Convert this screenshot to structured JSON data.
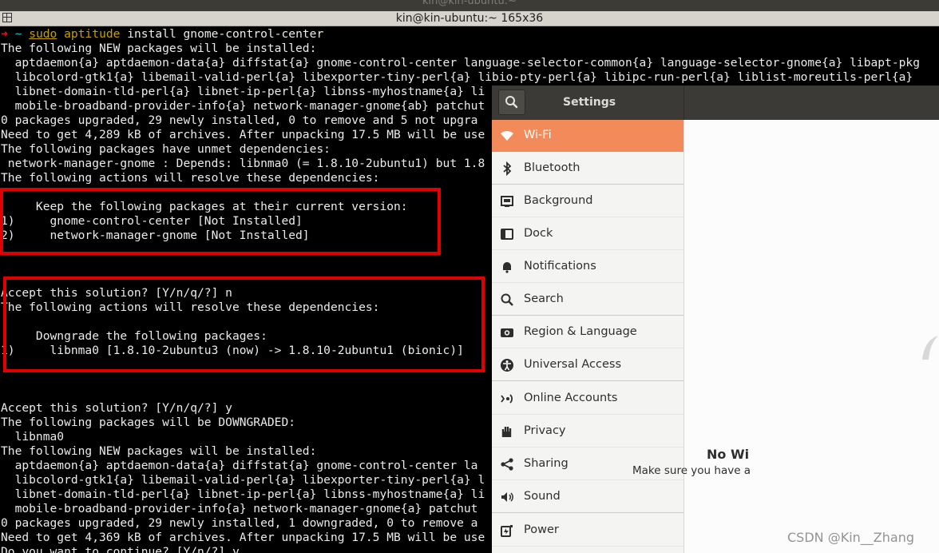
{
  "outer_window": {
    "title": "kin@kin-ubuntu:~"
  },
  "terminal": {
    "title": "kin@kin-ubuntu:~ 165x36",
    "prompt_arrow": "➜",
    "prompt_dir": "~",
    "command_sudo": "sudo",
    "command_aptitude": "aptitude",
    "command_rest": " install gnome-control-center",
    "lines": [
      "The following NEW packages will be installed:",
      "  aptdaemon{a} aptdaemon-data{a} diffstat{a} gnome-control-center language-selector-common{a} language-selector-gnome{a} libapt-pkg",
      "  libcolord-gtk1{a} libemail-valid-perl{a} libexporter-tiny-perl{a} libio-pty-perl{a} libipc-run-perl{a} liblist-moreutils-perl{a}",
      "  libnet-domain-tld-perl{a} libnet-ip-perl{a} libnss-myhostname{a} li",
      "  mobile-broadband-provider-info{a} network-manager-gnome{ab} patchut",
      "0 packages upgraded, 29 newly installed, 0 to remove and 5 not upgra",
      "Need to get 4,289 kB of archives. After unpacking 17.5 MB will be use",
      "The following packages have unmet dependencies:",
      " network-manager-gnome : Depends: libnma0 (= 1.8.10-2ubuntu1) but 1.8",
      "The following actions will resolve these dependencies:",
      "",
      "     Keep the following packages at their current version:",
      "1)     gnome-control-center [Not Installed]",
      "2)     network-manager-gnome [Not Installed]",
      "",
      "",
      "",
      "Accept this solution? [Y/n/q/?] n",
      "The following actions will resolve these dependencies:",
      "",
      "     Downgrade the following packages:",
      "1)     libnma0 [1.8.10-2ubuntu3 (now) -> 1.8.10-2ubuntu1 (bionic)]",
      "",
      "",
      "",
      "Accept this solution? [Y/n/q/?] y",
      "The following packages will be DOWNGRADED:",
      "  libnma0",
      "The following NEW packages will be installed:",
      "  aptdaemon{a} aptdaemon-data{a} diffstat{a} gnome-control-center la",
      "  libcolord-gtk1{a} libemail-valid-perl{a} libexporter-tiny-perl{a} l",
      "  libnet-domain-tld-perl{a} libnet-ip-perl{a} libnss-myhostname{a} li",
      "  mobile-broadband-provider-info{a} network-manager-gnome{a} patchut",
      "0 packages upgraded, 29 newly installed, 1 downgraded, 0 to remove a",
      "Need to get 4,369 kB of archives. After unpacking 17.5 MB will be use",
      "Do you want to continue? [Y/n/?] y"
    ]
  },
  "settings": {
    "title": "Settings",
    "nav": [
      {
        "label": "Wi-Fi",
        "icon": "wifi-icon",
        "selected": true
      },
      {
        "label": "Bluetooth",
        "icon": "bluetooth-icon"
      },
      {
        "label": "Background",
        "icon": "background-icon"
      },
      {
        "label": "Dock",
        "icon": "dock-icon"
      },
      {
        "label": "Notifications",
        "icon": "bell-icon"
      },
      {
        "label": "Search",
        "icon": "search-icon"
      },
      {
        "label": "Region & Language",
        "icon": "camera-icon"
      },
      {
        "label": "Universal Access",
        "icon": "accessibility-icon"
      },
      {
        "label": "Online Accounts",
        "icon": "online-accounts-icon"
      },
      {
        "label": "Privacy",
        "icon": "hand-icon"
      },
      {
        "label": "Sharing",
        "icon": "share-icon"
      },
      {
        "label": "Sound",
        "icon": "speaker-icon"
      },
      {
        "label": "Power",
        "icon": "power-icon"
      }
    ],
    "content": {
      "title": "No Wi",
      "description": "Make sure you have a"
    }
  },
  "watermark": "CSDN @Kin__Zhang",
  "colors": {
    "accent": "#f38a5a",
    "highlight_box": "#e00000",
    "terminal_bg": "#000000",
    "header_bg": "#3b3a36"
  }
}
